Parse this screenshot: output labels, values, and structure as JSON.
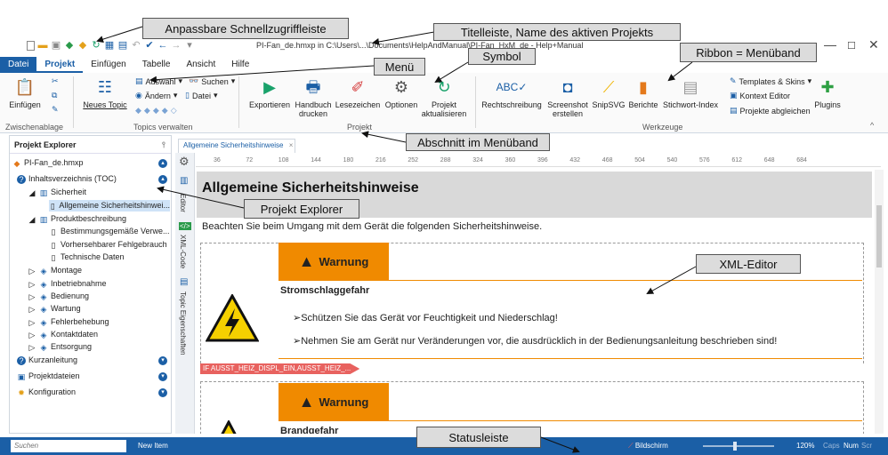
{
  "titlebar": {
    "title": "PI-Fan_de.hmxp in C:\\Users\\...\\Documents\\HelpAndManual\\PI-Fan_HxM_de - Help+Manual"
  },
  "menu": {
    "items": [
      "Datei",
      "Projekt",
      "Einfügen",
      "Tabelle",
      "Ansicht",
      "Hilfe"
    ]
  },
  "ribbon": {
    "einfuegen": "Einfügen",
    "group_clipboard": "Zwischenablage",
    "neues_topic": "Neues Topic",
    "auswahl": "Auswahl",
    "aendern": "Ändern",
    "suchen": "Suchen",
    "datei": "Datei",
    "group_topics": "Topics verwalten",
    "exportieren": "Exportieren",
    "handbuch_drucken": "Handbuch drucken",
    "lesezeichen": "Lesezeichen",
    "optionen": "Optionen",
    "projekt_aktualisieren": "Projekt aktualisieren",
    "group_projekt": "Projekt",
    "rechtschreibung": "Rechtschreibung",
    "screenshot_erstellen": "Screenshot erstellen",
    "snipsvg": "SnipSVG",
    "berichte": "Berichte",
    "stichwort_index": "Stichwort-Index",
    "templates_skins": "Templates & Skins",
    "kontext_editor": "Kontext Editor",
    "projekte_abgleichen": "Projekte abgleichen",
    "plugins": "Plugins",
    "group_werkzeuge": "Werkzeuge"
  },
  "explorer": {
    "header": "Projekt Explorer",
    "items": [
      {
        "label": "PI-Fan_de.hmxp"
      },
      {
        "label": "Inhaltsverzeichnis (TOC)"
      },
      {
        "label": "Sicherheit"
      },
      {
        "label": "Allgemeine Sicherheitshinwei..."
      },
      {
        "label": "Produktbeschreibung"
      },
      {
        "label": "Bestimmungsgemäße Verwe..."
      },
      {
        "label": "Vorhersehbarer Fehlgebrauch"
      },
      {
        "label": "Technische Daten"
      },
      {
        "label": "Montage"
      },
      {
        "label": "Inbetriebnahme"
      },
      {
        "label": "Bedienung"
      },
      {
        "label": "Wartung"
      },
      {
        "label": "Fehlerbehebung"
      },
      {
        "label": "Kontaktdaten"
      },
      {
        "label": "Entsorgung"
      },
      {
        "label": "Kurzanleitung"
      },
      {
        "label": "Projektdateien"
      },
      {
        "label": "Konfiguration"
      }
    ]
  },
  "sidebar": {
    "tab_editor": "Editor",
    "tab_xml": "XML-Code",
    "tab_props": "Topic Eigenschaften"
  },
  "document": {
    "tab_label": "Allgemeine Sicherheitshinweise",
    "ruler": [
      "36",
      "72",
      "108",
      "144",
      "180",
      "216",
      "252",
      "288",
      "324",
      "360",
      "396",
      "432",
      "468",
      "504",
      "540",
      "576",
      "612",
      "648",
      "684"
    ],
    "heading": "Allgemeine Sicherheitshinweise",
    "intro": "Beachten Sie beim Umgang mit dem Gerät die folgenden Sicherheitshinweise.",
    "warning_label": "Warnung",
    "hazard1_title": "Stromschlaggefahr",
    "hazard1_bullet1": "➢Schützen Sie das Gerät vor Feuchtigkeit und Niederschlag!",
    "hazard1_bullet2": "➢Nehmen Sie am Gerät nur Veränderungen vor, die ausdrücklich in der Bedienungsanleitung beschrieben sind!",
    "condition_tag": "IF AUSST_HEIZ_DISPL_EIN,AUSST_HEIZ_...",
    "hazard2_title": "Brandgefahr"
  },
  "statusbar": {
    "search_placeholder": "Suchen",
    "new_item": "New Item",
    "bildschirm": "Bildschirm",
    "zoom": "120%",
    "zoom_level": 0.45,
    "caps": "Caps",
    "num": "Num",
    "scr": "Scr"
  },
  "callouts": {
    "qat": "Anpassbare Schnellzugriffleiste",
    "titelleiste": "Titelleiste, Name des aktiven Projekts",
    "symbol": "Symbol",
    "ribbon": "Ribbon = Menüband",
    "menu": "Menü",
    "abschnitt": "Abschnitt im Menüband",
    "explorer": "Projekt Explorer",
    "xml_editor": "XML-Editor",
    "statusleiste": "Statusleiste"
  },
  "colors": {
    "accent": "#1b5fa6",
    "warning": "#f08a00",
    "condition": "#e8625f"
  }
}
